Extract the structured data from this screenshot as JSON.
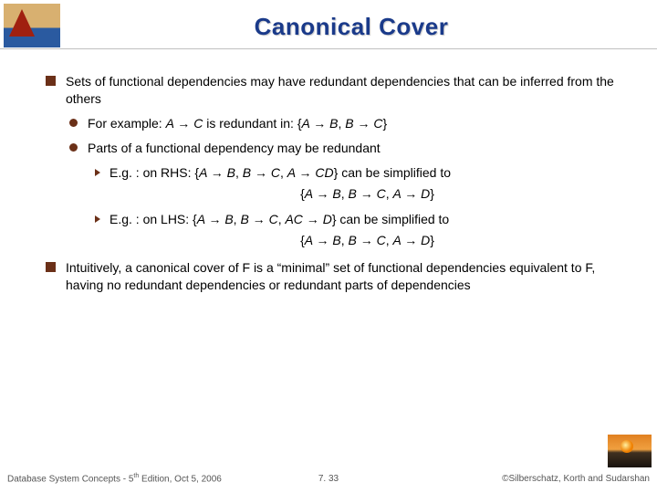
{
  "title": "Canonical Cover",
  "bullets": {
    "b1a": "Sets of functional dependencies may have redundant dependencies that can be inferred from the others",
    "b2a_pre": "For example:  ",
    "b2a_expr": "A → C",
    "b2a_mid": " is redundant in:   {",
    "b2a_fd1": "A → B",
    "b2a_sep": ",   ",
    "b2a_fd2": "B → C",
    "b2a_post": "}",
    "b2b": "Parts of a functional dependency may be redundant",
    "b3a_pre": "E.g. : on RHS:   {",
    "b3a_fd1": "A → B",
    "b3a_s1": ",   ",
    "b3a_fd2": "B → C",
    "b3a_s2": ",   ",
    "b3a_fd3": "A → CD",
    "b3a_post": "}  can be simplified to",
    "b3a_res_open": "{",
    "b3a_r1": "A → B",
    "b3a_rs1": ",   ",
    "b3a_r2": "B → C",
    "b3a_rs2": ",   ",
    "b3a_r3": "A → D",
    "b3a_res_close": "}",
    "b3b_pre": "E.g. : on LHS:    {",
    "b3b_fd1": "A → B",
    "b3b_s1": ",   ",
    "b3b_fd2": "B → C",
    "b3b_s2": ",   ",
    "b3b_fd3": "AC → D",
    "b3b_post": "}  can be simplified to",
    "b3b_res_open": "{",
    "b3b_r1": "A → B",
    "b3b_rs1": ",   ",
    "b3b_r2": "B → C",
    "b3b_rs2": ",   ",
    "b3b_r3": "A → D",
    "b3b_res_close": "}",
    "b1b": "Intuitively, a canonical cover of F is a “minimal” set of functional dependencies equivalent to F, having no redundant dependencies or redundant parts of dependencies"
  },
  "footer": {
    "left_a": "Database System Concepts - 5",
    "left_sup": "th",
    "left_b": " Edition, Oct 5, 2006",
    "mid": "7. 33",
    "right": "©Silberschatz, Korth and Sudarshan"
  }
}
